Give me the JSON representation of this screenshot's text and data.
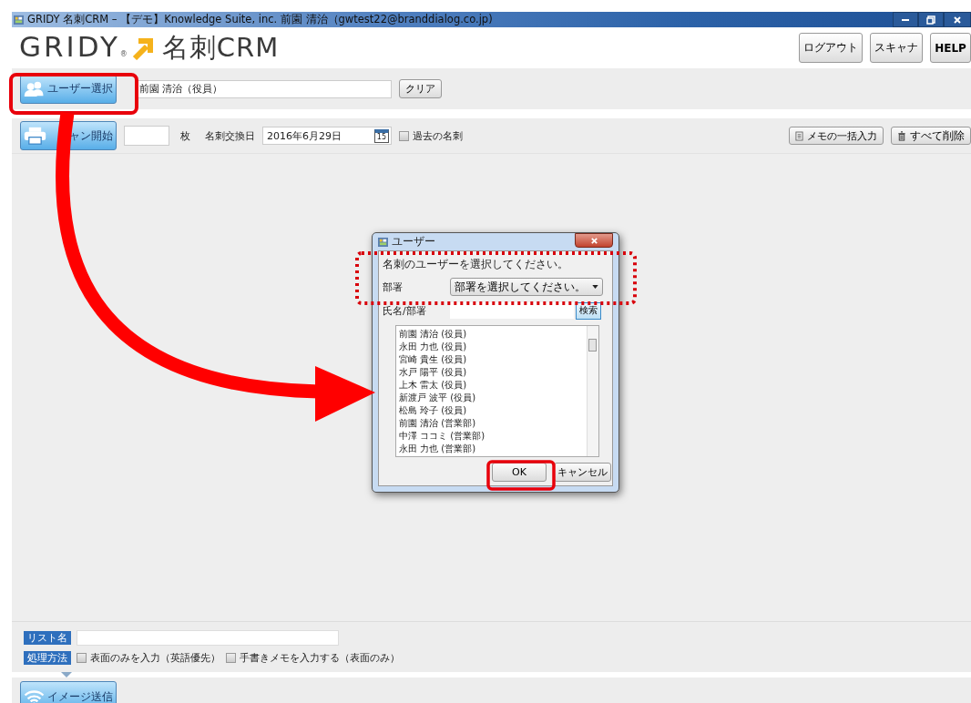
{
  "window": {
    "title": "GRIDY 名刺CRM – 【デモ】Knowledge Suite, inc. 前園 清治（gwtest22@branddialog.co.jp)"
  },
  "header": {
    "logo_text": "GRIDY",
    "logo_mark": "®",
    "product": "名刺CRM",
    "buttons": [
      "ログアウト",
      "スキャナ",
      "HELP"
    ]
  },
  "user_bar": {
    "button": "ユーザー選択",
    "value": "前園 清治（役員）",
    "clear": "クリア"
  },
  "scan_bar": {
    "button": "ャン開始",
    "count_unit": "枚",
    "date_label": "名刺交換日",
    "date": "2016年6月29日",
    "calendar_day": "15",
    "past_checkbox": {
      "label": "過去の名刺",
      "checked": false
    },
    "memo_button": "メモの一括入力",
    "delete_button": "すべて削除"
  },
  "dialog": {
    "title": "ユーザー",
    "prompt": "名刺のユーザーを選択してください。",
    "dept_label": "部署",
    "dept_select": "部署を選択してください。",
    "name_label": "氏名/部署",
    "search": "検索",
    "users": [
      {
        "label": "前園 清治 (役員)",
        "selected": false
      },
      {
        "label": "永田 力也 (役員)",
        "selected": false
      },
      {
        "label": "宮崎 貴生 (役員)",
        "selected": false
      },
      {
        "label": "水戸 陽平 (役員)",
        "selected": false
      },
      {
        "label": "上木 雷太 (役員)",
        "selected": false
      },
      {
        "label": "新渡戸 波平 (役員)",
        "selected": false
      },
      {
        "label": "松島 玲子 (役員)",
        "selected": false
      },
      {
        "label": "前園 清治 (営業部)",
        "selected": false
      },
      {
        "label": "中澤 ココミ (営業部)",
        "selected": false
      },
      {
        "label": "永田 力也 (営業部)",
        "selected": false
      }
    ],
    "ok": "OK",
    "cancel": "キャンセル"
  },
  "bottom": {
    "list_label": "リスト名",
    "method_label": "処理方法",
    "options": [
      {
        "label": "表面のみを入力（英語優先）",
        "checked": false
      },
      {
        "label": "手書きメモを入力する（表面のみ）",
        "checked": false
      }
    ],
    "send_button": "イメージ送信"
  }
}
